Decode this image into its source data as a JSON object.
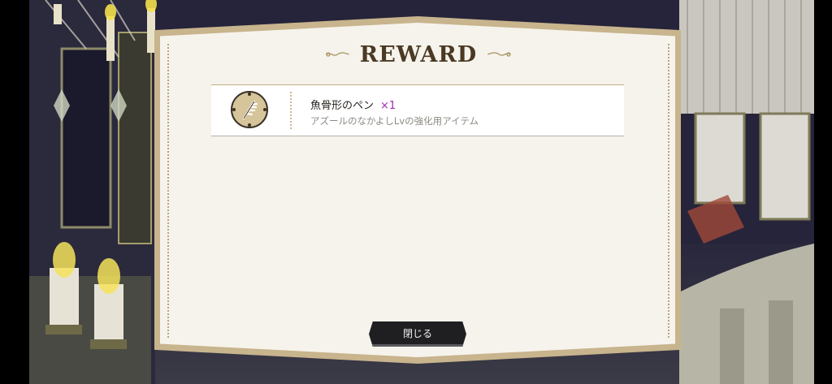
{
  "dialog": {
    "title": "REWARD"
  },
  "reward": {
    "item_name": "魚骨形のペン",
    "quantity": "×1",
    "description": "アズールのなかよしLvの強化用アイテム",
    "icon": "fishbone-pen-icon"
  },
  "buttons": {
    "close_label": "閉じる"
  },
  "colors": {
    "card_border": "#c8b48d",
    "card_fill": "#f6f3ec",
    "title": "#4a3a24",
    "quantity": "#a02bb1",
    "button": "#1f1f22"
  }
}
